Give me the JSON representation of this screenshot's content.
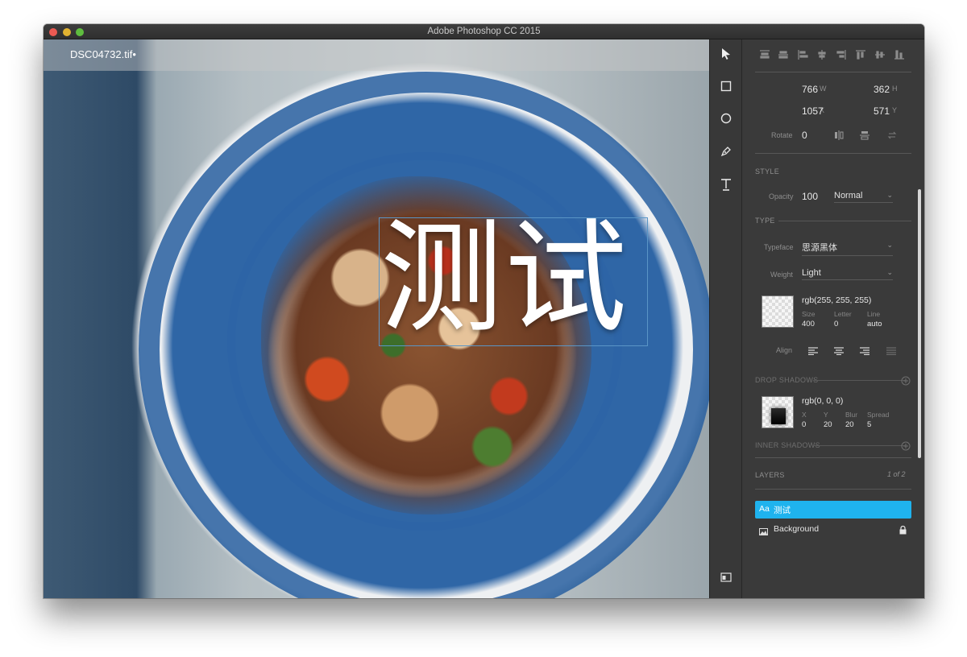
{
  "window": {
    "title": "Adobe Photoshop CC 2015"
  },
  "document": {
    "tab_name": "DSC04732.tif•",
    "text_layer_content": "测试"
  },
  "tools": [
    "select-arrow-icon",
    "rectangle-icon",
    "ellipse-icon",
    "pen-icon",
    "type-icon",
    "artboard-icon"
  ],
  "align": {
    "icons": [
      "align-left-edges-icon",
      "align-horizontal-centers-icon",
      "align-right-edges-icon",
      "align-top-edges-icon",
      "align-vertical-centers-icon",
      "align-bottom-edges-icon",
      "distribute-top-icon",
      "distribute-bottom-icon"
    ]
  },
  "transform": {
    "w_label": "W",
    "w_value": "766",
    "h_label": "H",
    "h_value": "362",
    "x_label": "X",
    "x_value": "1057",
    "y_label": "Y",
    "y_value": "571",
    "rotate_label": "Rotate",
    "rotate_value": "0"
  },
  "style": {
    "section": "STYLE",
    "opacity_label": "Opacity",
    "opacity_value": "100",
    "blend_mode": "Normal"
  },
  "type": {
    "section": "TYPE",
    "typeface_label": "Typeface",
    "typeface_value": "思源黑体",
    "weight_label": "Weight",
    "weight_value": "Light",
    "color_value": "rgb(255, 255, 255)",
    "size_label": "Size",
    "size_value": "400",
    "letter_label": "Letter",
    "letter_value": "0",
    "line_label": "Line",
    "line_value": "auto",
    "align_label": "Align"
  },
  "drop_shadows": {
    "section": "DROP SHADOWS",
    "color_value": "rgb(0, 0, 0)",
    "x_label": "X",
    "x_value": "0",
    "y_label": "Y",
    "y_value": "20",
    "blur_label": "Blur",
    "blur_value": "20",
    "spread_label": "Spread",
    "spread_value": "5"
  },
  "inner_shadows": {
    "section": "INNER SHADOWS"
  },
  "layers": {
    "section": "LAYERS",
    "count": "1 of 2",
    "items": [
      {
        "name": "测试",
        "kind_label": "Aa",
        "selected": true
      },
      {
        "name": "Background",
        "locked": true
      }
    ]
  },
  "colors": {
    "accent": "#1fb3ee",
    "panel": "#3a3a3a",
    "selection_box": "#5a95c6"
  }
}
